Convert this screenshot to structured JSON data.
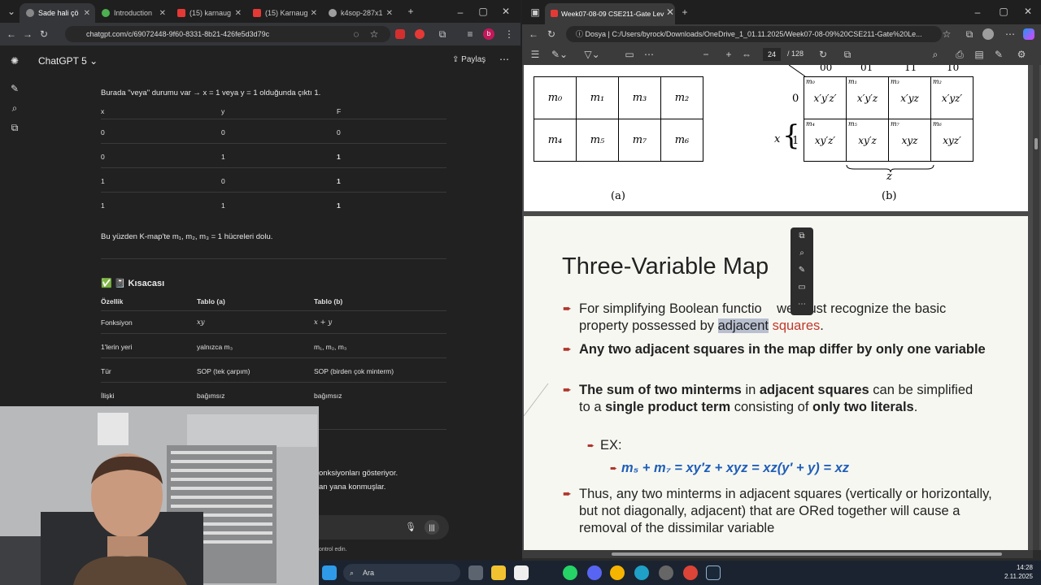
{
  "left_browser": {
    "tabs": [
      {
        "label": "Sade hali çö",
        "color": "#888"
      },
      {
        "label": "Introduction",
        "color": "#4caf50"
      },
      {
        "label": "(15) karnaug",
        "color": "#e53935"
      },
      {
        "label": "(15) Karnaug",
        "color": "#e53935"
      },
      {
        "label": "k4sop-287x1",
        "color": "#9e9e9e"
      }
    ],
    "url": "chatgpt.com/c/69072448-9f60-8331-8b21-426fe5d3d79c",
    "app_title": "ChatGPT 5",
    "share_label": "Paylaş",
    "intro_line": "Burada \"veya\" durumu var → x = 1 veya y = 1 olduğunda çıktı 1.",
    "truth_table": {
      "headers": [
        "x",
        "y",
        "F"
      ],
      "rows": [
        [
          "0",
          "0",
          "0"
        ],
        [
          "0",
          "1",
          "1"
        ],
        [
          "1",
          "0",
          "1"
        ],
        [
          "1",
          "1",
          "1"
        ]
      ]
    },
    "summary_line": "Bu yüzden K-map'te m₁, m₂, m₃ = 1 hücreleri dolu.",
    "section_title": "✅ 📓 Kısacası",
    "compare_table": {
      "headers": [
        "Özellik",
        "Tablo (a)",
        "Tablo (b)"
      ],
      "rows": [
        [
          "Fonksiyon",
          "xy",
          "x + y"
        ],
        [
          "1'lerin yeri",
          "yalnızca m₃",
          "m₁, m₂, m₃"
        ],
        [
          "Tür",
          "SOP (tek çarpım)",
          "SOP (birden çok minterm)"
        ],
        [
          "İlişki",
          "bağımsız",
          "bağımsız"
        ]
      ]
    },
    "partial_lines": [
      "onksiyonları gösteriyor.",
      "an yana konmuşlar.",
      "ontrol edin."
    ]
  },
  "right_browser": {
    "tab_label": "Week07-08-09 CSE211-Gate Lev",
    "url_prefix": "Dosya",
    "url": "C:/Users/byrock/Downloads/OneDrive_1_01.11.2025/Week07-08-09%20CSE211-Gate%20Le...",
    "page_num": "24",
    "page_total": "/ 128",
    "kmap_a": {
      "cells": [
        [
          "m₀",
          "m₁",
          "m₃",
          "m₂"
        ],
        [
          "m₄",
          "m₅",
          "m₇",
          "m₆"
        ]
      ],
      "caption": "(a)"
    },
    "kmap_b": {
      "col_headers": [
        "00",
        "01",
        "11",
        "10"
      ],
      "row_labels": [
        "0",
        "1"
      ],
      "row_var": "x",
      "bottom_var": "z",
      "cells": [
        [
          "x′y′z′",
          "x′y′z",
          "x′yz",
          "x′yz′"
        ],
        [
          "xy′z′",
          "xy′z",
          "xyz",
          "xyz′"
        ]
      ],
      "subs": [
        [
          "m₀",
          "m₁",
          "m₃",
          "m₂"
        ],
        [
          "m₄",
          "m₅",
          "m₇",
          "m₆"
        ]
      ],
      "caption": "(b)"
    },
    "slide_title": "Three-Variable Map",
    "bullets": {
      "b1_a": "For simplifying Boolean functio",
      "b1_b": "we must recognize the basic",
      "b1_c": "property possessed by ",
      "b1_hl": "adjacent",
      "b1_red": " squares",
      "b2": "Any two adjacent squares in the map differ by only one variable",
      "b3_1": "The sum of two minterms",
      "b3_2": " in ",
      "b3_3": "adjacent squares",
      "b3_4": " can be simplified to a ",
      "b3_5": "single product term",
      "b3_6": " consisting of ",
      "b3_7": "only two literals",
      "ex": "EX:",
      "formula": "m₅ + m₇ = xy′z + xyz = xz(y′ + y) = xz",
      "b4": "Thus, any two minterms in adjacent squares (vertically or horizontally, but not diagonally, adjacent) that are ORed together will cause a removal of the dissimilar variable"
    }
  },
  "taskbar": {
    "search": "Ara",
    "time": "14:28",
    "date": "2.11.2025"
  }
}
